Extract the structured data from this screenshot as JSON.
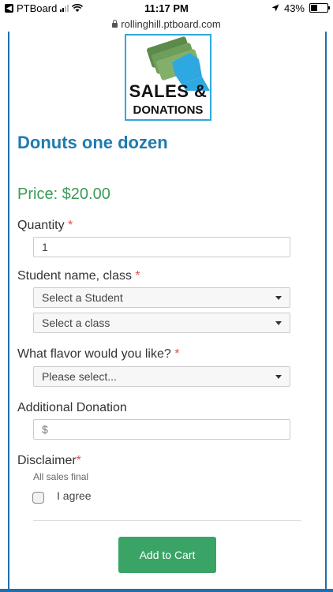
{
  "status_bar": {
    "app_back": "PTBoard",
    "time": "11:17 PM",
    "battery": "43%",
    "battery_level": 0.43
  },
  "url_bar": {
    "url": "rollinghill.ptboard.com"
  },
  "logo": {
    "line1": "SALES &",
    "line2": "DONATIONS"
  },
  "product": {
    "title": "Donuts one dozen",
    "price": "Price: $20.00"
  },
  "form": {
    "quantity": {
      "label": "Quantity",
      "required": "*",
      "value": "1"
    },
    "student": {
      "label": "Student name, class",
      "required": "*",
      "student_select": "Select a Student",
      "class_select": "Select a class"
    },
    "flavor": {
      "label": "What flavor would you like?",
      "required": "*",
      "select": "Please select..."
    },
    "donation": {
      "label": "Additional Donation",
      "placeholder": "$"
    },
    "disclaimer": {
      "label": "Disclaimer",
      "required": "*",
      "note": "All sales final",
      "agree": "I agree"
    },
    "submit": "Add to Cart"
  },
  "colors": {
    "brand_blue": "#1f7bb0",
    "price_green": "#3a9b56",
    "button_green": "#3aa366",
    "required_red": "#d9534f"
  }
}
